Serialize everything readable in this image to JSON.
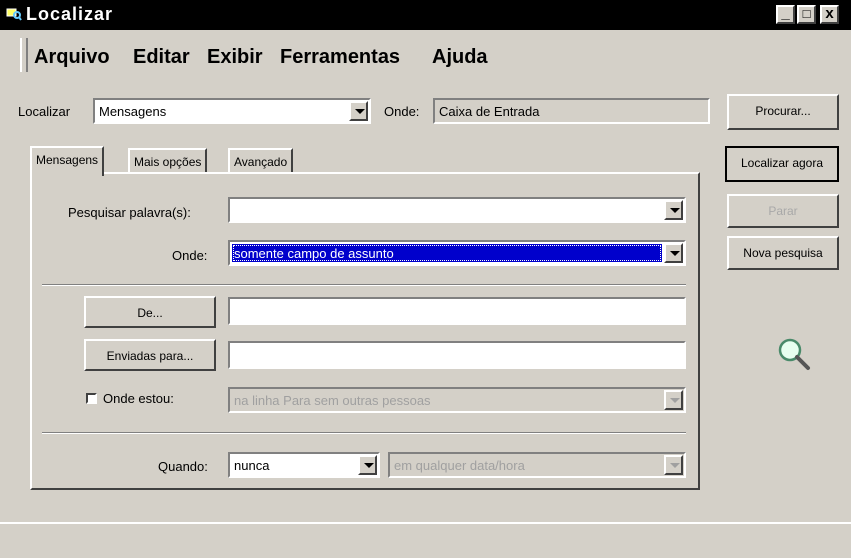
{
  "window": {
    "title": "Localizar",
    "minimize": "_",
    "maximize": "□",
    "close": "x"
  },
  "menu": [
    "Arquivo",
    "Editar",
    "Exibir",
    "Ferramentas",
    "Ajuda"
  ],
  "search_bar": {
    "localizar_label": "Localizar",
    "localizar_value": "Mensagens",
    "onde_label": "Onde:",
    "onde_value": "Caixa de Entrada"
  },
  "tabs": [
    "Mensagens",
    "Mais opções",
    "Avançado"
  ],
  "form": {
    "pesquisar_label": "Pesquisar palavra(s):",
    "pesquisar_value": "",
    "onde_label": "Onde:",
    "onde_value": "somente campo de assunto",
    "de_button": "De...",
    "de_value": "",
    "enviadas_button": "Enviadas para...",
    "enviadas_value": "",
    "onde_estou_label": "Onde estou:",
    "onde_estou_value": "na linha Para sem outras pessoas",
    "quando_label": "Quando:",
    "quando_value": "nunca",
    "data_value": "em qualquer data/hora"
  },
  "buttons": {
    "procurar": "Procurar...",
    "localizar_agora": "Localizar agora",
    "parar": "Parar",
    "nova_pesquisa": "Nova pesquisa"
  },
  "icons": {
    "search": "magnifier-icon",
    "app": "find-icon"
  },
  "colors": {
    "selection": "#0000cc",
    "face": "#d4d0c8",
    "titlebar": "#000000"
  }
}
